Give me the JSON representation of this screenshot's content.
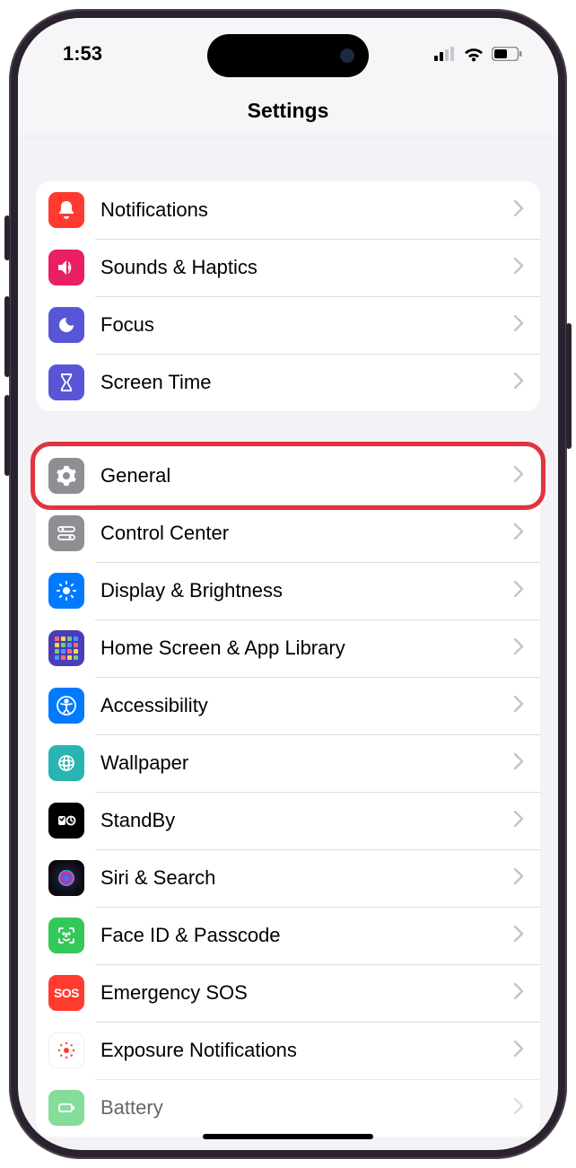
{
  "status": {
    "time": "1:53"
  },
  "header": {
    "title": "Settings"
  },
  "groups": {
    "g1": {
      "notifications": "Notifications",
      "sounds": "Sounds & Haptics",
      "focus": "Focus",
      "screentime": "Screen Time"
    },
    "g2": {
      "general": "General",
      "controlcenter": "Control Center",
      "display": "Display & Brightness",
      "homescreen": "Home Screen & App Library",
      "accessibility": "Accessibility",
      "wallpaper": "Wallpaper",
      "standby": "StandBy",
      "siri": "Siri & Search",
      "faceid": "Face ID & Passcode",
      "sos": "Emergency SOS",
      "exposure": "Exposure Notifications",
      "battery": "Battery"
    }
  },
  "highlighted_row": "general",
  "sos_text": "SOS"
}
